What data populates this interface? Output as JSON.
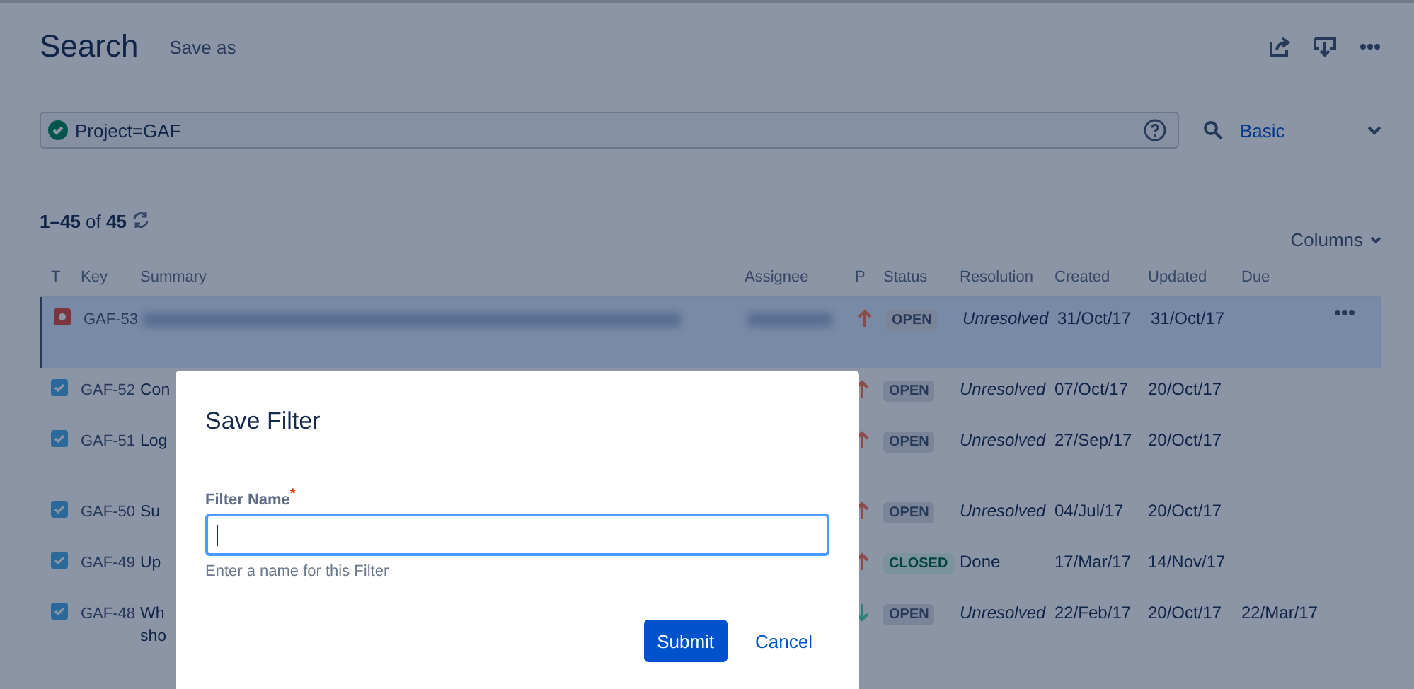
{
  "header": {
    "title": "Search",
    "save_as": "Save as"
  },
  "search": {
    "query": "Project=GAF",
    "valid": true,
    "mode": "Basic"
  },
  "results": {
    "range": "1–45",
    "of": "of",
    "total": "45",
    "columns_button": "Columns"
  },
  "table": {
    "columns": [
      "T",
      "Key",
      "Summary",
      "Assignee",
      "P",
      "Status",
      "Resolution",
      "Created",
      "Updated",
      "Due"
    ],
    "rows": [
      {
        "type": {
          "kind": "bug"
        },
        "key": "GAF-53",
        "blurred": true,
        "selected": true,
        "priority": {
          "kind": "up"
        },
        "status": {
          "label": "OPEN",
          "kind": "open"
        },
        "resolution": "Unresolved",
        "resolved": false,
        "created": "31/Oct/17",
        "updated": "31/Oct/17"
      },
      {
        "type": {
          "kind": "task"
        },
        "key": "GAF-52",
        "summary": "Con",
        "blurred": false,
        "selected": false,
        "priority": {
          "kind": "up"
        },
        "status": {
          "label": "OPEN",
          "kind": "open"
        },
        "resolution": "Unresolved",
        "resolved": false,
        "created": "07/Oct/17",
        "updated": "20/Oct/17"
      },
      {
        "type": {
          "kind": "task"
        },
        "key": "GAF-51",
        "summary": "Log",
        "blurred": false,
        "selected": false,
        "priority": {
          "kind": "up"
        },
        "status": {
          "label": "OPEN",
          "kind": "open"
        },
        "resolution": "Unresolved",
        "resolved": false,
        "created": "27/Sep/17",
        "updated": "20/Oct/17"
      },
      {
        "type": {
          "kind": "task"
        },
        "key": "GAF-50",
        "summary": "Su",
        "blurred": false,
        "selected": false,
        "priority": {
          "kind": "up"
        },
        "status": {
          "label": "OPEN",
          "kind": "open"
        },
        "resolution": "Unresolved",
        "resolved": false,
        "created": "04/Jul/17",
        "updated": "20/Oct/17"
      },
      {
        "type": {
          "kind": "task"
        },
        "key": "GAF-49",
        "summary": "Up",
        "blurred": false,
        "selected": false,
        "priority": {
          "kind": "up"
        },
        "status": {
          "label": "CLOSED",
          "kind": "closed"
        },
        "resolution": "Done",
        "resolved": true,
        "created": "17/Mar/17",
        "updated": "14/Nov/17"
      },
      {
        "type": {
          "kind": "task"
        },
        "key": "GAF-48",
        "summary": "Wh\nsho",
        "blurred": false,
        "selected": false,
        "priority": {
          "kind": "down"
        },
        "status": {
          "label": "OPEN",
          "kind": "open"
        },
        "resolution": "Unresolved",
        "resolved": false,
        "created": "22/Feb/17",
        "updated": "20/Oct/17",
        "due": "22/Mar/17"
      }
    ]
  },
  "dialog": {
    "title": "Save Filter",
    "field_label": "Filter Name",
    "required_mark": "*",
    "focused": true,
    "hint": "Enter a name for this Filter",
    "submit": "Submit",
    "cancel": "Cancel"
  }
}
